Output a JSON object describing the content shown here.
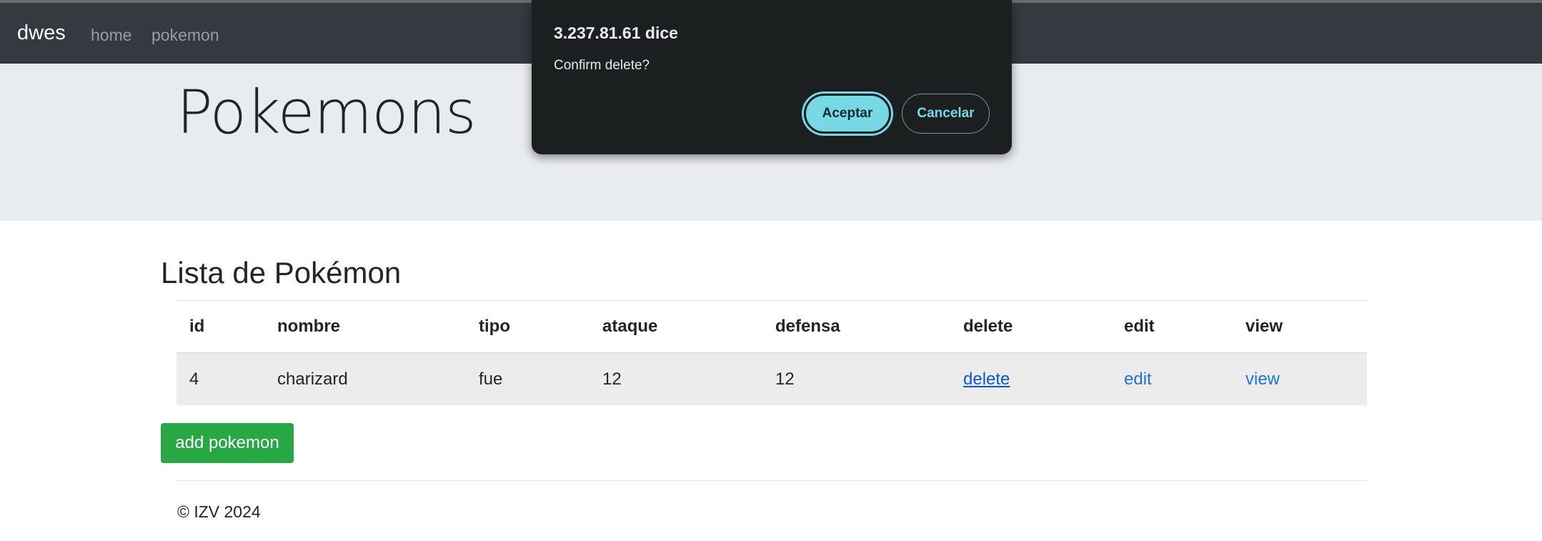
{
  "navbar": {
    "brand": "dwes",
    "links": [
      "home",
      "pokemon"
    ]
  },
  "jumbotron": {
    "title": "Pokemons"
  },
  "section": {
    "title": "Lista de Pokémon"
  },
  "table": {
    "headers": [
      "id",
      "nombre",
      "tipo",
      "ataque",
      "defensa",
      "delete",
      "edit",
      "view"
    ],
    "rows": [
      {
        "id": "4",
        "nombre": "charizard",
        "tipo": "fue",
        "ataque": "12",
        "defensa": "12",
        "delete": "delete",
        "edit": "edit",
        "view": "view"
      }
    ]
  },
  "actions": {
    "add_label": "add pokemon"
  },
  "footer": {
    "text": "© IZV 2024"
  },
  "dialog": {
    "title": "3.237.81.61 dice",
    "message": "Confirm delete?",
    "accept_label": "Aceptar",
    "cancel_label": "Cancelar"
  },
  "colors": {
    "navbar": "#343a40",
    "jumbotron": "#e9ecef",
    "add_button": "#28a745",
    "link": "#1a73d9",
    "dialog_bg": "#1c1f20",
    "dialog_accent": "#78d9e6"
  }
}
